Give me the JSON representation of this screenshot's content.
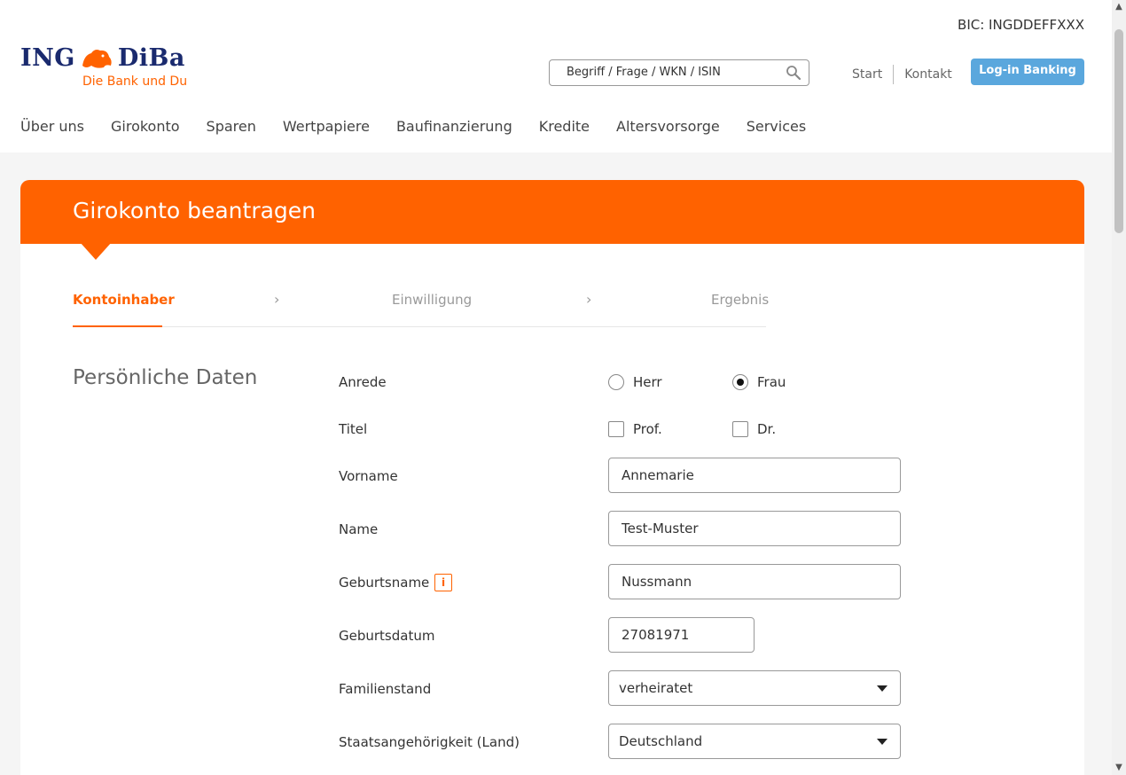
{
  "header": {
    "bic": "BIC: INGDDEFFXXX",
    "logo_left": "ING",
    "logo_right": "DiBa",
    "logo_sub": "Die Bank und Du",
    "search_placeholder": "Begriff / Frage / WKN / ISIN",
    "links": [
      "Start",
      "Kontakt"
    ],
    "login_label": "Log-in Banking"
  },
  "nav": {
    "items": [
      "Über uns",
      "Girokonto",
      "Sparen",
      "Wertpapiere",
      "Baufinanzierung",
      "Kredite",
      "Altersvorsorge",
      "Services"
    ]
  },
  "banner": {
    "title": "Girokonto beantragen"
  },
  "steps": {
    "items": [
      "Kontoinhaber",
      "Einwilligung",
      "Ergebnis"
    ],
    "active": 0
  },
  "form": {
    "section_title": "Persönliche Daten",
    "anrede_label": "Anrede",
    "anrede_options": [
      "Herr",
      "Frau"
    ],
    "anrede_selected": "Frau",
    "titel_label": "Titel",
    "titel_options": [
      "Prof.",
      "Dr."
    ],
    "vorname_label": "Vorname",
    "vorname_value": "Annemarie",
    "name_label": "Name",
    "name_value": "Test-Muster",
    "geburtsname_label": "Geburtsname",
    "geburtsname_info": "i",
    "geburtsname_value": "Nussmann",
    "geburtsdatum_label": "Geburtsdatum",
    "geburtsdatum_value": "27081971",
    "familienstand_label": "Familienstand",
    "familienstand_value": "verheiratet",
    "staat_label": "Staatsangehörigkeit (Land)",
    "staat_value": "Deutschland"
  },
  "colors": {
    "brand_orange": "#ff6200",
    "brand_navy": "#1a2a6e",
    "login_blue": "#5aa7dd"
  }
}
